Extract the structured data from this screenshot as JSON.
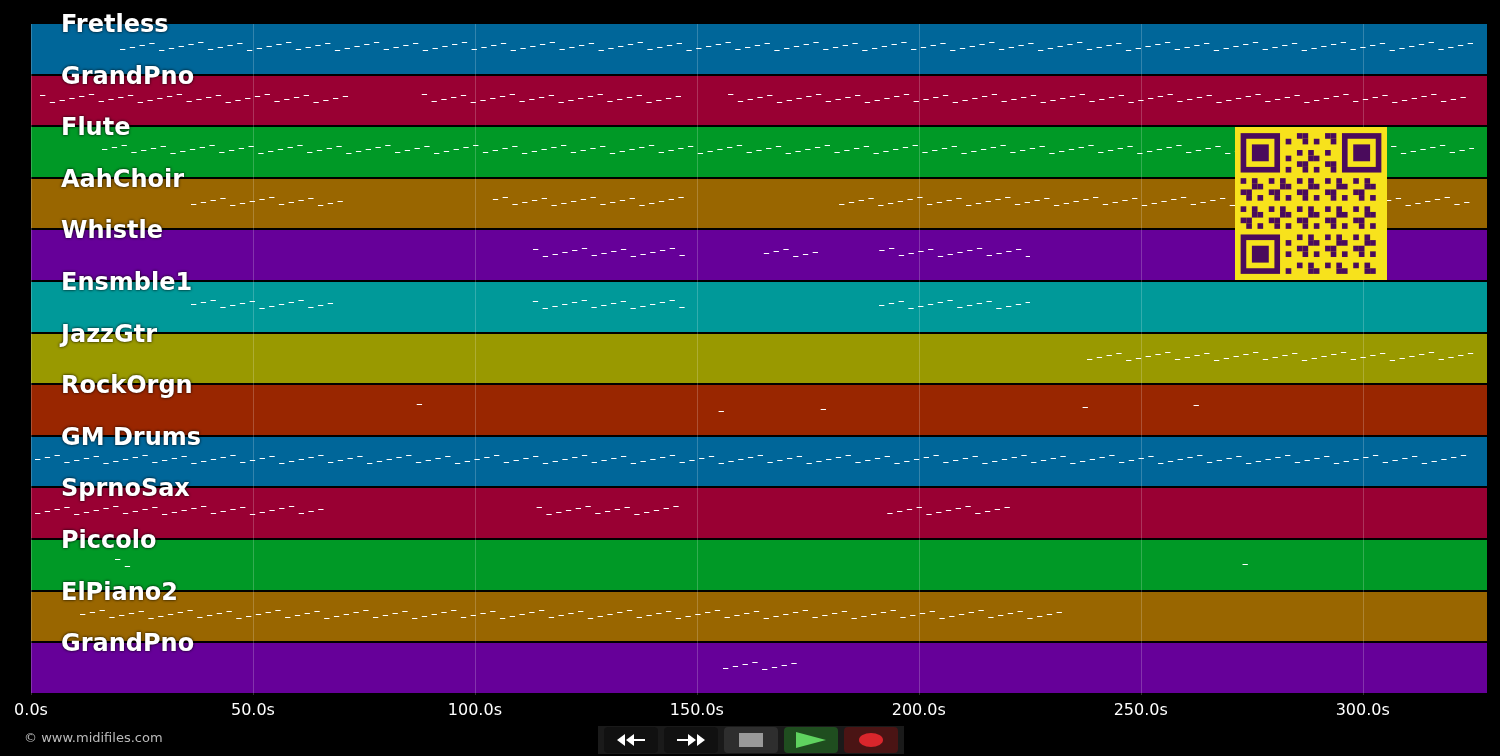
{
  "tracks": [
    {
      "name": "Fretless",
      "color": "#006699"
    },
    {
      "name": "GrandPno",
      "color": "#990033"
    },
    {
      "name": "Flute",
      "color": "#009926"
    },
    {
      "name": "AahChoir",
      "color": "#996600"
    },
    {
      "name": "Whistle",
      "color": "#660099"
    },
    {
      "name": "Ensmble1",
      "color": "#009999"
    },
    {
      "name": "JazzGtr",
      "color": "#999900"
    },
    {
      "name": "RockOrgn",
      "color": "#992600"
    },
    {
      "name": "GM Drums",
      "color": "#006699"
    },
    {
      "name": "SprnoSax",
      "color": "#990033"
    },
    {
      "name": "Piccolo",
      "color": "#009926"
    },
    {
      "name": "ElPiano2",
      "color": "#996600"
    },
    {
      "name": "GrandPno",
      "color": "#660099"
    }
  ],
  "axis": {
    "ticks": [
      "0.0s",
      "50.0s",
      "100.0s",
      "150.0s",
      "200.0s",
      "250.0s",
      "300.0s"
    ]
  },
  "credit": "© www.midifiles.com",
  "transport": [
    {
      "kind": "rewind"
    },
    {
      "kind": "forward"
    },
    {
      "kind": "stop"
    },
    {
      "kind": "play"
    },
    {
      "kind": "record"
    }
  ]
}
